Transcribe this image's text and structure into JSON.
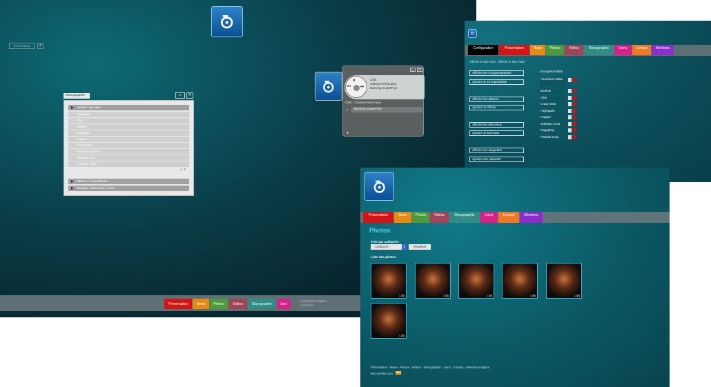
{
  "main_window": {
    "presentation_label": "Présentation",
    "discography": {
      "title": "Discographie",
      "section_artists": "Artistes / groupes",
      "artists": [
        "Highagain",
        "Clint",
        "Beelow",
        "Kagayboy",
        "Hopper",
        "Crazy Bear",
        "Aluminium Babe",
        "Pamela Hula",
        "JukeBox Club"
      ],
      "section_albums": "Albums / Compilations",
      "section_songs": "Musique / Morceaux / Sons"
    },
    "player": {
      "artist": "Clint",
      "album": "ClasseAmericaine",
      "track": "Burning SuperFive",
      "path": "Clint / ClasseAmericaine",
      "playlist_item": "Burning SuperFive"
    },
    "bottom_nav": [
      {
        "label": "Présentation",
        "color": "#d41414"
      },
      {
        "label": "News",
        "color": "#e58a12"
      },
      {
        "label": "Photos",
        "color": "#4b9a3c"
      },
      {
        "label": "Vidéos",
        "color": "#a0445a"
      },
      {
        "label": "Discographie",
        "color": "#2f8c86"
      },
      {
        "label": "Lien",
        "color": "#d7208a"
      }
    ],
    "footer_links": [
      "> Mentions Légales",
      "> Contact"
    ]
  },
  "admin_window": {
    "tabs": [
      {
        "label": "Configuration",
        "color": "#000000"
      },
      {
        "label": "Présentation",
        "color": "#d41414"
      },
      {
        "label": "News",
        "color": "#e58a12"
      },
      {
        "label": "Photos",
        "color": "#4b9a3c"
      },
      {
        "label": "Vidéos",
        "color": "#a0445a"
      },
      {
        "label": "Discographie",
        "color": "#2f8c86"
      },
      {
        "label": "Liens",
        "color": "#d7208a"
      },
      {
        "label": "Contact",
        "color": "#f07a24"
      },
      {
        "label": "Mentions",
        "color": "#8a2fc9"
      }
    ],
    "breadcrumb": "Afficher le Site Html  -  Afficher le Site Flash",
    "buttons": [
      "Afficher les Groupes/artistes",
      "Ajouter un Groupe/artiste",
      "Afficher les Albums",
      "Ajouter un Album",
      "Afficher les Morceaux",
      "Ajouter un Morceau",
      "Afficher les Jaquettes",
      "Ajouter une Jaquette"
    ],
    "groups_title": "Groupes/Artists",
    "groups": [
      "Aluminum Babe",
      "Beelow",
      "Clint",
      "Crazy Bear",
      "Highagain",
      "Hopper",
      "JukeBox Club",
      "Kagayboy",
      "Pamela Hula"
    ]
  },
  "photos_window": {
    "tabs": [
      {
        "label": "Présentation",
        "color": "#d41414"
      },
      {
        "label": "News",
        "color": "#e58a12"
      },
      {
        "label": "Photos",
        "color": "#4b9a3c"
      },
      {
        "label": "Vidéos",
        "color": "#a0445a"
      },
      {
        "label": "Discographie",
        "color": "#2f8c86"
      },
      {
        "label": "Liens",
        "color": "#d7208a"
      },
      {
        "label": "Contact",
        "color": "#f07a24"
      },
      {
        "label": "Mentions",
        "color": "#8a2fc9"
      }
    ],
    "heading": "Photos",
    "sort_label": "Trier par catégorie :",
    "category_value": "- Catégorie -",
    "visualize_button": "Visualiser",
    "list_title": "Liste des photos",
    "photo_tag": "Lilia",
    "footer_links": "Présentation  -  News  -  Photos  -  Vidéos  -  Discographie  -  Liens  -  Contact  -  Mentions Légales",
    "footer_site": "BeComFlex.com",
    "footer_badge": "RSS"
  }
}
